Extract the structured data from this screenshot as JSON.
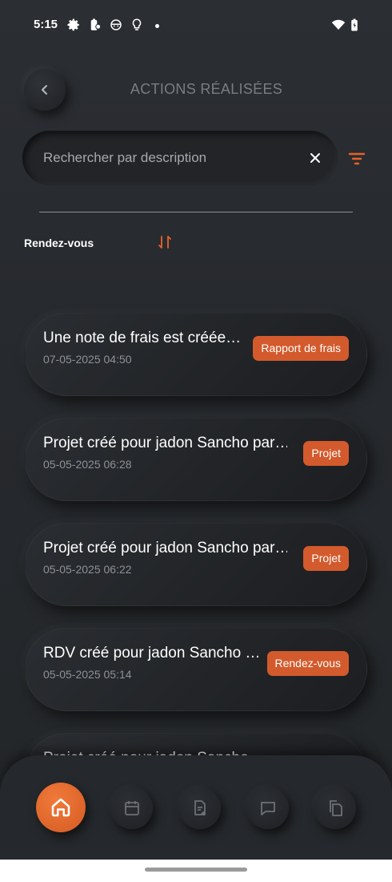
{
  "status_bar": {
    "time": "5:15"
  },
  "header": {
    "title": "ACTIONS RÉALISÉES"
  },
  "search": {
    "placeholder": "Rechercher par description",
    "value": ""
  },
  "sort": {
    "label": "Rendez-vous"
  },
  "colors": {
    "accent": "#d35a2c",
    "background": "#26292d"
  },
  "actions": [
    {
      "title": "Une note de frais est créée…",
      "date": "07-05-2025 04:50",
      "badge": "Rapport de frais"
    },
    {
      "title": "Projet créé pour jadon Sancho par…",
      "date": "05-05-2025 06:28",
      "badge": "Projet"
    },
    {
      "title": "Projet créé pour jadon Sancho par…",
      "date": "05-05-2025 06:22",
      "badge": "Projet"
    },
    {
      "title": "RDV créé pour jadon Sancho …",
      "date": "05-05-2025 05:14",
      "badge": "Rendez-vous"
    },
    {
      "title": "Projet créé pour jadon Sancho",
      "date": "",
      "badge": ""
    }
  ],
  "nav": {
    "items": [
      "home-icon",
      "calendar-icon",
      "document-add-icon",
      "chat-icon",
      "files-icon"
    ]
  }
}
